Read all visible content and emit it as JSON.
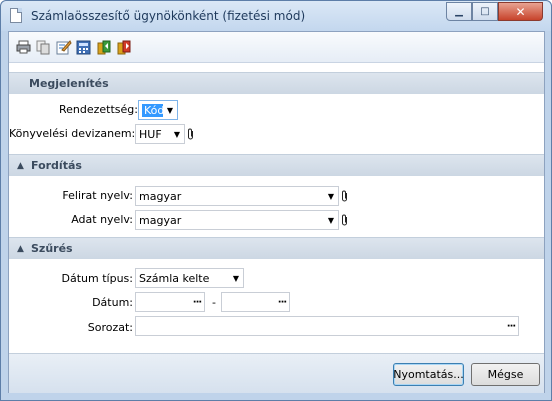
{
  "window": {
    "title": "Számlaösszesítő ügynökönként (fizetési mód)"
  },
  "toolbar": {
    "icons": [
      "printer-icon",
      "copy-icon",
      "edit-icon",
      "calculator-icon",
      "export-icon",
      "import-icon"
    ]
  },
  "sections": {
    "display": {
      "title": "Megjelenítés"
    },
    "translation": {
      "title": "Fordítás"
    },
    "filter": {
      "title": "Szűrés"
    }
  },
  "fields": {
    "ordering": {
      "label": "Rendezettség:",
      "value": "Kód"
    },
    "currency": {
      "label": "Könyvelési devizanem:",
      "value": "HUF"
    },
    "caption_lang": {
      "label": "Felirat nyelv:",
      "value": "magyar"
    },
    "data_lang": {
      "label": "Adat nyelv:",
      "value": "magyar"
    },
    "date_type": {
      "label": "Dátum típus:",
      "value": "Számla kelte"
    },
    "date": {
      "label": "Dátum:",
      "from": "",
      "separator": "-",
      "to": ""
    },
    "series": {
      "label": "Sorozat:",
      "value": ""
    }
  },
  "buttons": {
    "print": "Nyomtatás...",
    "cancel": "Mégse"
  },
  "colors": {
    "frame": "#bfd3ea",
    "section": "#d3dde8",
    "selection": "#3399ff"
  }
}
